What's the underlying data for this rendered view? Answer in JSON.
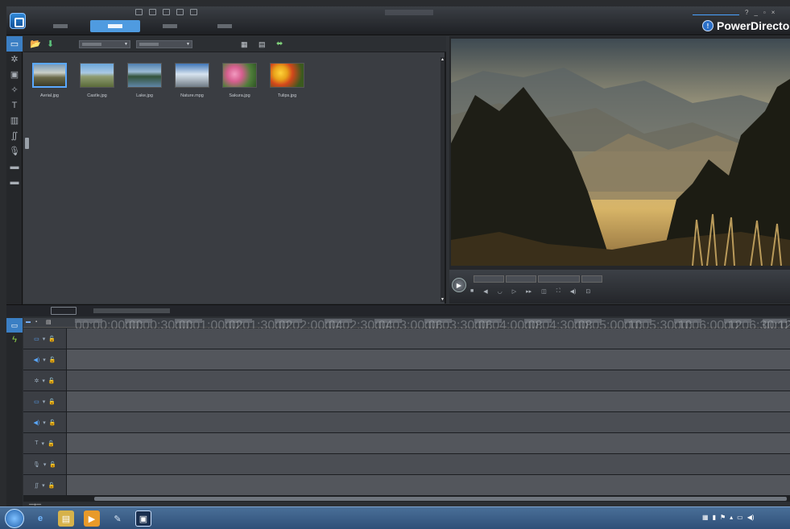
{
  "window": {
    "title": "",
    "sign_in_link": "",
    "brand": "PowerDirector",
    "controls": [
      "?",
      "_",
      "▫",
      "×"
    ]
  },
  "menu": {
    "items": [
      "",
      "",
      "",
      ""
    ]
  },
  "mode_tabs": [
    {
      "label": "",
      "active": false
    },
    {
      "label": "",
      "active": true
    },
    {
      "label": "",
      "active": false
    },
    {
      "label": "",
      "active": false
    }
  ],
  "rail": {
    "icons": [
      "media-room-icon",
      "effect-room-icon",
      "pip-room-icon",
      "particle-room-icon",
      "title-room-icon",
      "transition-room-icon",
      "audio-mixing-icon",
      "voice-over-icon",
      "chapter-icon",
      "subtitle-icon"
    ]
  },
  "library": {
    "filter_dropdown": "",
    "sort_dropdown": "",
    "items": [
      {
        "label": "Aerial.jpg",
        "selected": true
      },
      {
        "label": "Castle.jpg",
        "selected": false
      },
      {
        "label": "Lake.jpg",
        "selected": false
      },
      {
        "label": "Nature.mpg",
        "selected": false
      },
      {
        "label": "Sakura.jpg",
        "selected": false
      },
      {
        "label": "Tulips.jpg",
        "selected": false
      }
    ]
  },
  "player": {
    "mode_clip": "",
    "mode_movie": "",
    "timecode": "",
    "zoom": ""
  },
  "timeline": {
    "mode_button": "",
    "hint": "",
    "ruler_ticks": [
      "00;00;00;00",
      "00;00;30;00",
      "00;01;00;02",
      "00;01;30;02",
      "00;02;00;04",
      "00;02;30;04",
      "00;03;00;06",
      "00;03;30;06",
      "00;04;00;08",
      "00;04;30;08",
      "00;05;00;10",
      "00;05;30;10",
      "00;06;00;12",
      "00;06;30;12",
      "00;07;00;14"
    ],
    "tracks": [
      "video-track",
      "audio-track",
      "effect-track",
      "video-track",
      "audio-track",
      "title-track",
      "voice-track",
      "music-track"
    ]
  },
  "taskbar": {
    "time": "",
    "date": ""
  }
}
